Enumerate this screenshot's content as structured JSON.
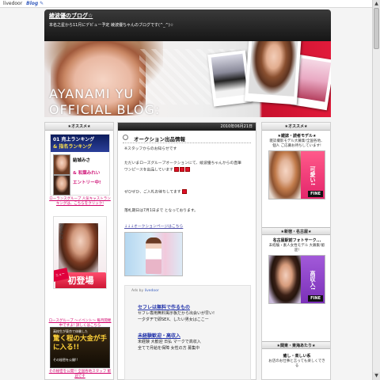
{
  "toolbar": {
    "brand": "livedoor",
    "blog": "Blog",
    "pen": "✎"
  },
  "header": {
    "title": "綾波優のブログ☆",
    "description": "本名之星から11月にデビュー予定 綾波優ちゃんのブログです(^_^)☆"
  },
  "banner": {
    "line1": "AYANAMI YU",
    "line2": "OFFICIAL BLOG:"
  },
  "left_sidebar": {
    "heading": "★オススメ★",
    "ad_ranking": {
      "top_line1": "01 売上ランキング",
      "top_line2": "& 指名ランキング",
      "name1": "結城みさ",
      "name2": "& 和葉みれい",
      "name3": "エントリー中!",
      "caption": "ローランスグループ 人気キャストランキングは、こちらをクリック!"
    },
    "ad_debut": {
      "vertical_name": "雅名みな",
      "badge": "初登場",
      "ribbon": "ニュー",
      "caption": "ロースグループ ～イベント～ 毎月開催中ですよ! 詳しくはこちら"
    },
    "ad_money": {
      "small": "高校生が東京で体験した",
      "big": "驚く程の大金が手に入る!!",
      "bottom": "その秘密を公開!!",
      "caption": "その秘密を公開!! 全国各地スタッフ 歓迎です"
    }
  },
  "post": {
    "date": "2010年06月21日",
    "title": "オークション出品情報",
    "line1": "※スタッフからのお知らせです",
    "line2": "ただいまローズグループオークションにて、綾波優ちゃんからの直筆",
    "line3": "ワンピースを出品しています",
    "line4": "ぜひぜひ、ご入札お待ちしてます",
    "line5": "落札期日は7月1日まで となっております。",
    "link": "↓↓↓オークションページはこちら"
  },
  "ads_by": {
    "prefix": "Ads by ",
    "brand": "livedoor"
  },
  "ad_items": [
    {
      "headline": "セフレは無料で作るもの",
      "desc1": "セフレ専用無料掲示板だから出会いが早い!",
      "desc2": "一夕ダヂで即SEX、したい男女はここー"
    },
    {
      "headline": "未経験歓迎・高収入",
      "desc1": "未経験 大歓迎 日払 マークで高収入",
      "desc2": "全てで月給を保障 女性の方 募集中"
    }
  ],
  "right_sidebar": {
    "heading1": "★オススメ★",
    "ad1": {
      "cat": "★雑誌・読者モデル★",
      "cat2": "雑誌撮影モデル大募集!全国各地、個人 ご応募お待ちしています!",
      "tag": "可愛い!",
      "fine": "FINE"
    },
    "heading2": "★新宿・名古屋★",
    "ad2": {
      "cat": "名古屋駅前フォトサーク...",
      "cat2": "未経験・素人女性モデル 大募集!歓迎!",
      "tag": "高収入!",
      "fine": "FINE"
    },
    "heading3": "★関東・東海あたり★",
    "ad3": {
      "cat": "癒し・楽しい系",
      "cat2": "お店のお仕事と言っても楽しくできる"
    }
  }
}
